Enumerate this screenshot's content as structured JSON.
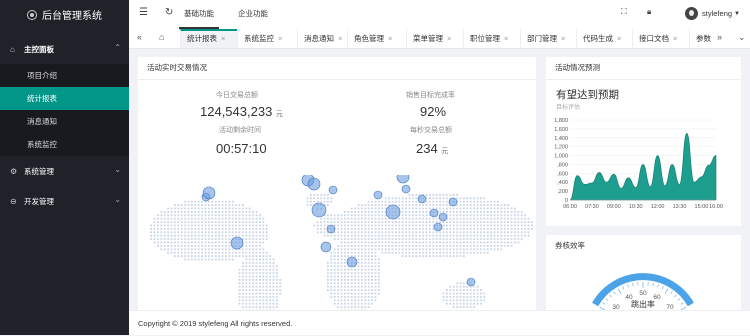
{
  "app": {
    "title": "后台管理系统"
  },
  "sidebar": {
    "groups": [
      {
        "label": "主控面板",
        "items": [
          {
            "label": "项目介绍"
          },
          {
            "label": "统计报表",
            "active": true
          },
          {
            "label": "消息通知"
          },
          {
            "label": "系统监控"
          }
        ]
      },
      {
        "label": "系统管理"
      },
      {
        "label": "开发管理"
      }
    ]
  },
  "topbar": {
    "tabs": [
      {
        "label": "基础功能",
        "active": true
      },
      {
        "label": "企业功能"
      }
    ],
    "user": "stylefeng"
  },
  "page_tabs": [
    "统计报表",
    "系统监控",
    "消息通知",
    "角色管理",
    "菜单管理",
    "职位管理",
    "部门管理",
    "代码生成",
    "接口文档",
    "参数"
  ],
  "realtime": {
    "title": "活动实时交易情况",
    "stats": [
      {
        "label": "今日交易总额",
        "value": "124,543,233",
        "unit": "元"
      },
      {
        "label": "销售目标完成率",
        "value": "92%",
        "unit": ""
      },
      {
        "label": "活动剩余时间",
        "value": "00:57:10",
        "unit": ""
      },
      {
        "label": "每秒交易总额",
        "value": "234",
        "unit": "元"
      }
    ]
  },
  "forecast": {
    "title": "活动情况预测",
    "headline": "有望达到预期",
    "sub": "目标评估",
    "chart_data": {
      "type": "area",
      "x": [
        "06:00",
        "06:30",
        "07:00",
        "07:30",
        "08:00",
        "08:30",
        "09:00",
        "09:30",
        "10:00",
        "10:30",
        "11:00",
        "11:30",
        "12:00",
        "12:30",
        "13:00",
        "13:30",
        "14:00",
        "14:30",
        "15:00",
        "15:30",
        "16:00"
      ],
      "values": [
        0,
        550,
        350,
        380,
        620,
        400,
        580,
        260,
        500,
        280,
        800,
        300,
        1000,
        320,
        800,
        350,
        1500,
        400,
        520,
        780,
        1000
      ],
      "ylim": [
        0,
        1800
      ],
      "yticks": [
        "0",
        ",200",
        ",400",
        ",600",
        ",800",
        "1,000",
        "1,200",
        "1,400",
        "1,600",
        "1,800"
      ],
      "xticks": [
        "06:00",
        "07:30",
        "09:00",
        "10:30",
        "12:00",
        "13:30",
        "15:00",
        "16:00"
      ],
      "color": "#1d9e8e"
    }
  },
  "efficiency": {
    "title": "券核效率",
    "gauge_label": "跳出率",
    "gauge_ticks": [
      "30",
      "40",
      "50",
      "60",
      "70"
    ]
  },
  "footer": {
    "text": "Copyright © 2019 stylefeng All rights reserved."
  }
}
